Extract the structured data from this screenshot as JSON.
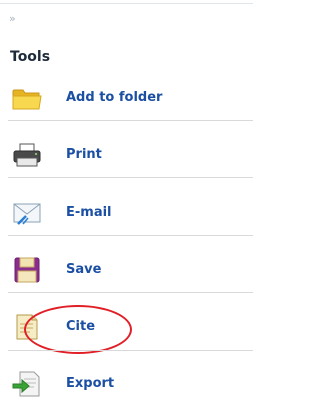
{
  "panel": {
    "collapse_glyph": "»",
    "heading": "Tools",
    "items": [
      {
        "label": "Add to folder",
        "icon": "folder-icon"
      },
      {
        "label": "Print",
        "icon": "printer-icon"
      },
      {
        "label": "E-mail",
        "icon": "email-icon"
      },
      {
        "label": "Save",
        "icon": "save-icon"
      },
      {
        "label": "Cite",
        "icon": "cite-icon"
      },
      {
        "label": "Export",
        "icon": "export-icon"
      }
    ]
  },
  "colors": {
    "label_blue": "#1b4fa3",
    "highlight_red": "#e11f27",
    "divider": "#d9d9d9"
  }
}
